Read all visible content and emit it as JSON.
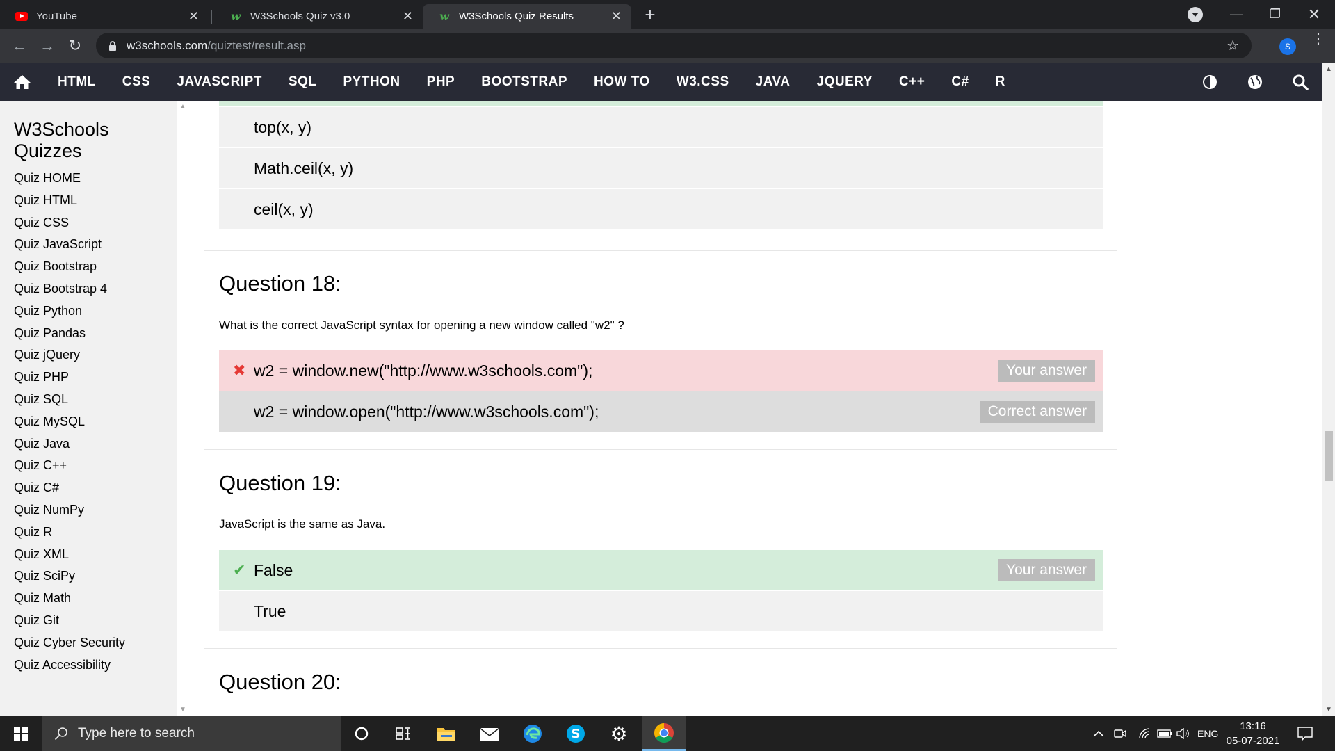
{
  "browser": {
    "tabs": [
      {
        "title": "YouTube",
        "icon": "youtube-icon",
        "active": false
      },
      {
        "title": "W3Schools Quiz v3.0",
        "icon": "w3schools-icon",
        "active": false
      },
      {
        "title": "W3Schools Quiz Results",
        "icon": "w3schools-icon",
        "active": true
      }
    ],
    "url_host": "w3schools.com",
    "url_path": "/quiztest/result.asp",
    "profile_initial": "S"
  },
  "topnav": {
    "items": [
      "HTML",
      "CSS",
      "JAVASCRIPT",
      "SQL",
      "PYTHON",
      "PHP",
      "BOOTSTRAP",
      "HOW TO",
      "W3.CSS",
      "JAVA",
      "JQUERY",
      "C++",
      "C#",
      "R"
    ]
  },
  "sidebar": {
    "title": "W3Schools Quizzes",
    "items": [
      "Quiz HOME",
      "Quiz HTML",
      "Quiz CSS",
      "Quiz JavaScript",
      "Quiz Bootstrap",
      "Quiz Bootstrap 4",
      "Quiz Python",
      "Quiz Pandas",
      "Quiz jQuery",
      "Quiz PHP",
      "Quiz SQL",
      "Quiz MySQL",
      "Quiz Java",
      "Quiz C++",
      "Quiz C#",
      "Quiz NumPy",
      "Quiz R",
      "Quiz XML",
      "Quiz SciPy",
      "Quiz Math",
      "Quiz Git",
      "Quiz Cyber Security",
      "Quiz Accessibility"
    ]
  },
  "main": {
    "prev_options": [
      "top(x, y)",
      "Math.ceil(x, y)",
      "ceil(x, y)"
    ],
    "q18": {
      "title": "Question 18:",
      "text": "What is the correct JavaScript syntax for opening a new window called \"w2\" ?",
      "options": [
        {
          "text": "w2 = window.new(\"http://www.w3schools.com\");",
          "badge": "Your answer",
          "status": "wrong"
        },
        {
          "text": "w2 = window.open(\"http://www.w3schools.com\");",
          "badge": "Correct answer",
          "status": "correct-answer"
        }
      ]
    },
    "q19": {
      "title": "Question 19:",
      "text": "JavaScript is the same as Java.",
      "options": [
        {
          "text": "False",
          "badge": "Your answer",
          "status": "correct"
        },
        {
          "text": "True",
          "badge": "",
          "status": "none"
        }
      ]
    },
    "q20": {
      "title": "Question 20:"
    }
  },
  "taskbar": {
    "search_placeholder": "Type here to search",
    "language": "ENG",
    "time": "13:16",
    "date": "05-07-2021"
  }
}
